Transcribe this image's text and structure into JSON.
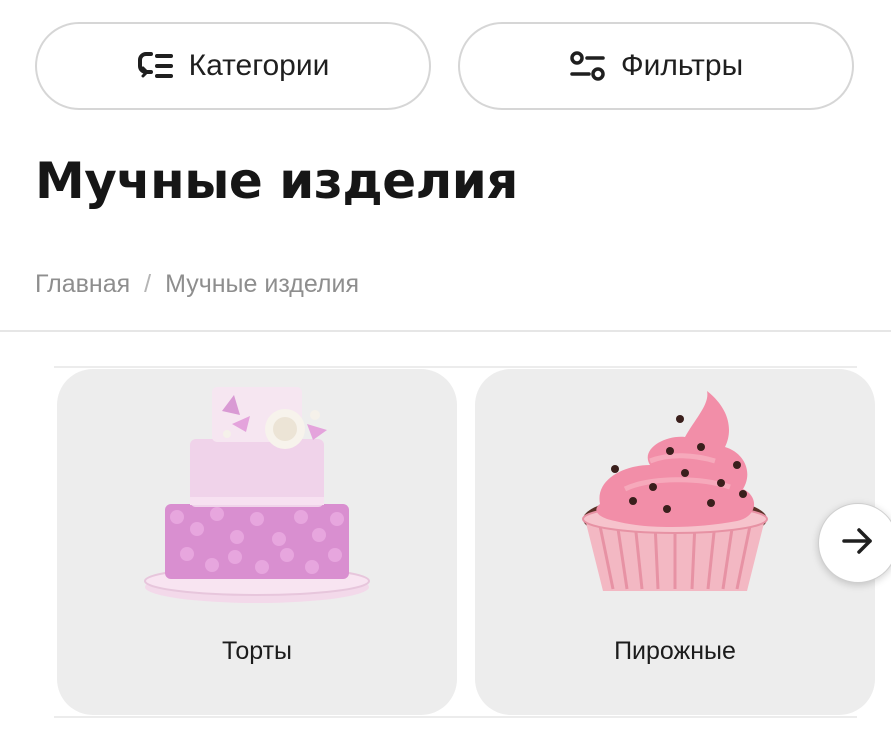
{
  "toolbar": {
    "categories_label": "Категории",
    "filters_label": "Фильтры"
  },
  "page": {
    "title": "Мучные изделия"
  },
  "breadcrumb": {
    "items": [
      "Главная",
      "Мучные изделия"
    ],
    "separator": "/"
  },
  "categories": [
    {
      "label": "Торты",
      "icon": "layered-cake-image"
    },
    {
      "label": "Пирожные",
      "icon": "cupcake-image"
    }
  ],
  "carousel": {
    "next_icon": "arrow-right-icon"
  },
  "colors": {
    "card_bg": "#ededed",
    "text": "#1a1a1a",
    "muted": "#8e8e8e",
    "cake_pink": "#e7b6d9",
    "frosting_pink": "#f28ea8"
  }
}
